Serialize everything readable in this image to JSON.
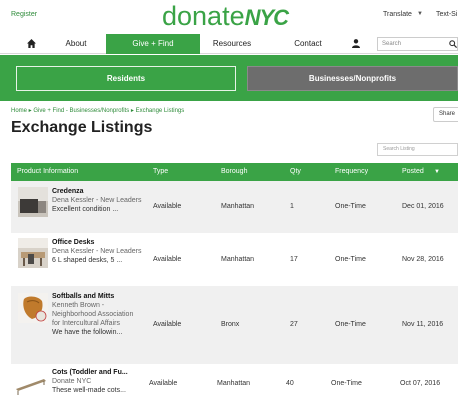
{
  "header": {
    "register": "Register",
    "logo_donate": "donate",
    "logo_nyc": "NYC",
    "translate": "Translate",
    "textsize": "Text-Si"
  },
  "nav": {
    "about": "About",
    "give_find": "Give + Find",
    "resources": "Resources",
    "contact": "Contact",
    "search_placeholder": "Search"
  },
  "toggle": {
    "residents": "Residents",
    "businesses": "Businesses/Nonprofits"
  },
  "breadcrumb": "Home ▸ Give + Find - Businesses/Nonprofits ▸ Exchange Listings",
  "page_title": "Exchange Listings",
  "share": "Share",
  "search_listing_placeholder": "Search Listing",
  "table": {
    "headers": [
      "Product Information",
      "Type",
      "Borough",
      "Qty",
      "Frequency",
      "Posted"
    ],
    "rows": [
      {
        "name": "Credenza",
        "poster": "Dena Kessler - New Leaders",
        "desc": "Excellent condition ...",
        "type": "Available",
        "borough": "Manhattan",
        "qty": "1",
        "frequency": "One-Time",
        "posted": "Dec 01, 2016"
      },
      {
        "name": "Office Desks",
        "poster": "Dena Kessler - New Leaders",
        "desc": "6 L shaped desks, 5 ...",
        "type": "Available",
        "borough": "Manhattan",
        "qty": "17",
        "frequency": "One-Time",
        "posted": "Nov 28, 2016"
      },
      {
        "name": "Softballs and Mitts",
        "poster": "Kenneth Brown - Neighborhood Association for Intercultural Affairs",
        "desc": "We have the followin...",
        "type": "Available",
        "borough": "Bronx",
        "qty": "27",
        "frequency": "One-Time",
        "posted": "Nov 11, 2016"
      },
      {
        "name": "Cots (Toddler and Fu...",
        "poster": "Donate NYC",
        "desc": "These well-made cots...",
        "type": "Available",
        "borough": "Manhattan",
        "qty": "40",
        "frequency": "One-Time",
        "posted": "Oct 07, 2016"
      }
    ]
  },
  "colors": {
    "brand_green": "#3aa346",
    "toggle_gray": "#6d6d6d"
  }
}
